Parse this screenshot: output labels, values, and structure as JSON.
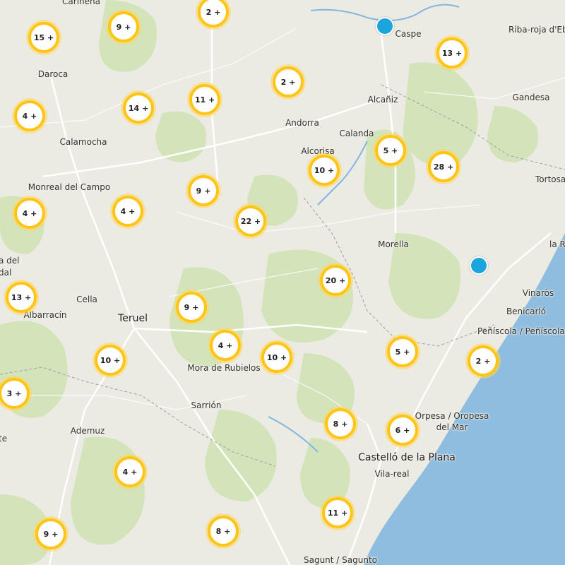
{
  "colors": {
    "land": "#ecebe3",
    "vegetation": "#cfe3b4",
    "sea": "#8fbde0",
    "roads": "#ffffff",
    "cluster_ring": "#ffc414",
    "marker": "#1aa6dc"
  },
  "places": [
    {
      "name": "Caspe",
      "big": false
    },
    {
      "name": "Riba-roja d'Ebre",
      "big": false
    },
    {
      "name": "Daroca",
      "big": false
    },
    {
      "name": "Alcañiz",
      "big": false
    },
    {
      "name": "Gandesa",
      "big": false
    },
    {
      "name": "Andorra",
      "big": false
    },
    {
      "name": "Calanda",
      "big": false
    },
    {
      "name": "Calamocha",
      "big": false
    },
    {
      "name": "Alcorisa",
      "big": false
    },
    {
      "name": "Tortosa",
      "big": false
    },
    {
      "name": "Monreal del Campo",
      "big": false
    },
    {
      "name": "Morella",
      "big": false
    },
    {
      "name": "la R",
      "big": false
    },
    {
      "name": "a del",
      "big": false
    },
    {
      "name": "dal",
      "big": false
    },
    {
      "name": "Vinaròs",
      "big": false
    },
    {
      "name": "Cella",
      "big": false
    },
    {
      "name": "Benicarló",
      "big": false
    },
    {
      "name": "Albarracín",
      "big": false
    },
    {
      "name": "Teruel",
      "big": true
    },
    {
      "name": "Peñíscola / Peñíscola",
      "big": false
    },
    {
      "name": "Mora de Rubielos",
      "big": false
    },
    {
      "name": "Sarrión",
      "big": false
    },
    {
      "name": "Orpesa / Oropesa",
      "big": false
    },
    {
      "name": "del Mar",
      "big": false
    },
    {
      "name": "Ademuz",
      "big": false
    },
    {
      "name": "te",
      "big": false
    },
    {
      "name": "Castelló de la Plana",
      "big": true
    },
    {
      "name": "Vila-real",
      "big": false
    },
    {
      "name": "Sagunt / Sagunto",
      "big": false
    },
    {
      "name": "Carineña",
      "big": false
    }
  ],
  "clusters": [
    "2 +",
    "9 +",
    "15 +",
    "13 +",
    "2 +",
    "11 +",
    "14 +",
    "4 +",
    "5 +",
    "28 +",
    "10 +",
    "9 +",
    "4 +",
    "22 +",
    "4 +",
    "20 +",
    "13 +",
    "9 +",
    "4 +",
    "10 +",
    "10 +",
    "5 +",
    "2 +",
    "3 +",
    "8 +",
    "6 +",
    "4 +",
    "11 +",
    "8 +",
    "9 +"
  ],
  "markers": [
    "marker-caspe",
    "marker-vinaros"
  ]
}
